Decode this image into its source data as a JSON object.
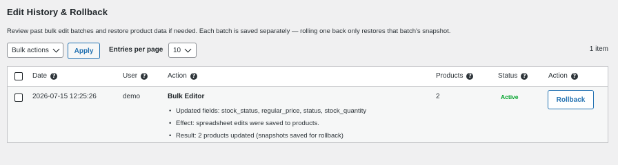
{
  "page": {
    "title": "Edit History & Rollback",
    "description": "Review past bulk edit batches and restore product data if needed. Each batch is saved separately — rolling one back only restores that batch's snapshot."
  },
  "toolbar": {
    "bulk_actions": "Bulk actions",
    "apply_label": "Apply",
    "entries_label": "Entries per page",
    "entries_value": "10",
    "item_count": "1 item"
  },
  "table": {
    "headers": {
      "date": "Date",
      "user": "User",
      "action": "Action",
      "products": "Products",
      "status": "Status",
      "action2": "Action"
    },
    "rows": [
      {
        "date": "2026-07-15 12:25:26",
        "user": "demo",
        "action_title": "Bulk Editor",
        "details": [
          "Updated fields: stock_status, regular_price, status, stock_quantity",
          "Effect: spreadsheet edits were saved to products.",
          "Result: 2 products updated (snapshots saved for rollback)"
        ],
        "products": "2",
        "status": "Active",
        "rollback_label": "Rollback"
      }
    ]
  },
  "icons": {
    "help": "?"
  },
  "colors": {
    "accent": "#2271b1",
    "status_active": "#00a32a",
    "background": "#f0f0f1"
  }
}
